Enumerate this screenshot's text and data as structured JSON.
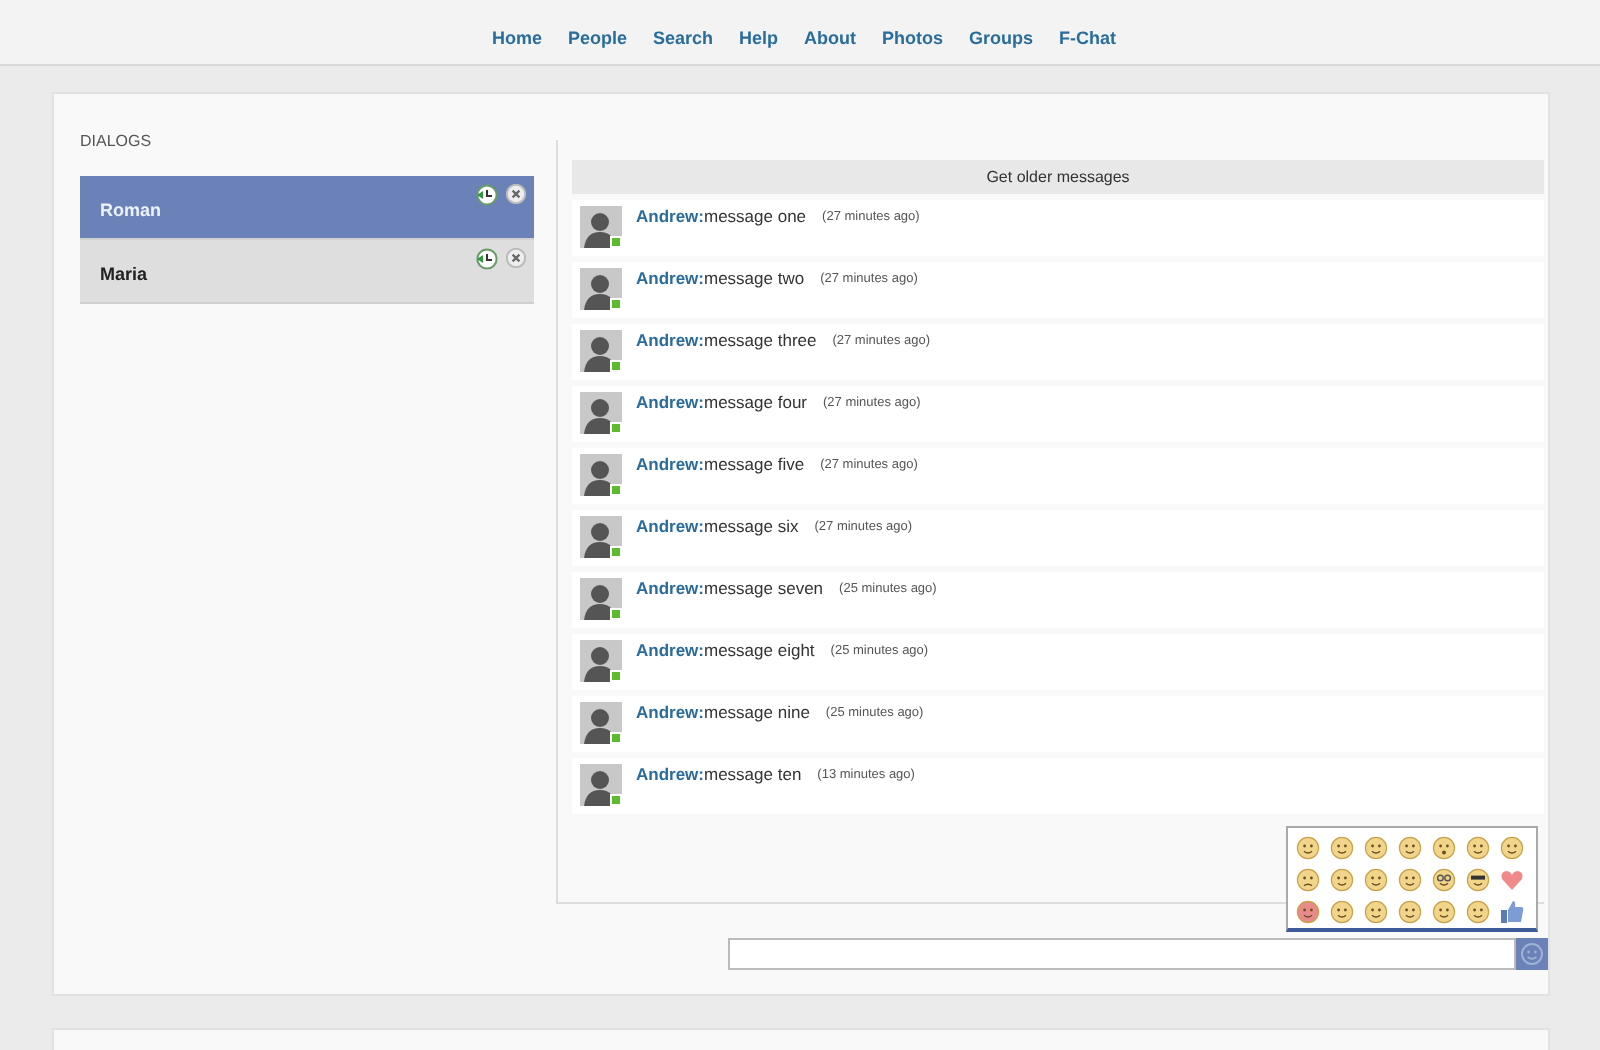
{
  "nav": [
    "Home",
    "People",
    "Search",
    "Help",
    "About",
    "Photos",
    "Groups",
    "F-Chat"
  ],
  "dialogs": {
    "title": "DIALOGS",
    "items": [
      {
        "name": "Roman",
        "selected": true
      },
      {
        "name": "Maria",
        "selected": false
      }
    ]
  },
  "messages": {
    "older_button": "Get older messages",
    "items": [
      {
        "author": "Andrew:",
        "text": "message one",
        "time": "(27 minutes ago)",
        "online": true
      },
      {
        "author": "Andrew:",
        "text": "message two",
        "time": "(27 minutes ago)",
        "online": true
      },
      {
        "author": "Andrew:",
        "text": "message three",
        "time": "(27 minutes ago)",
        "online": true
      },
      {
        "author": "Andrew:",
        "text": "message four",
        "time": "(27 minutes ago)",
        "online": true
      },
      {
        "author": "Andrew:",
        "text": "message five",
        "time": "(27 minutes ago)",
        "online": true
      },
      {
        "author": "Andrew:",
        "text": "message six",
        "time": "(27 minutes ago)",
        "online": true
      },
      {
        "author": "Andrew:",
        "text": "message seven",
        "time": "(25 minutes ago)",
        "online": true
      },
      {
        "author": "Andrew:",
        "text": "message eight",
        "time": "(25 minutes ago)",
        "online": true
      },
      {
        "author": "Andrew:",
        "text": "message nine",
        "time": "(25 minutes ago)",
        "online": true
      },
      {
        "author": "Andrew:",
        "text": "message ten",
        "time": "(13 minutes ago)",
        "online": true
      }
    ]
  },
  "emoji_picker": {
    "open": true
  }
}
